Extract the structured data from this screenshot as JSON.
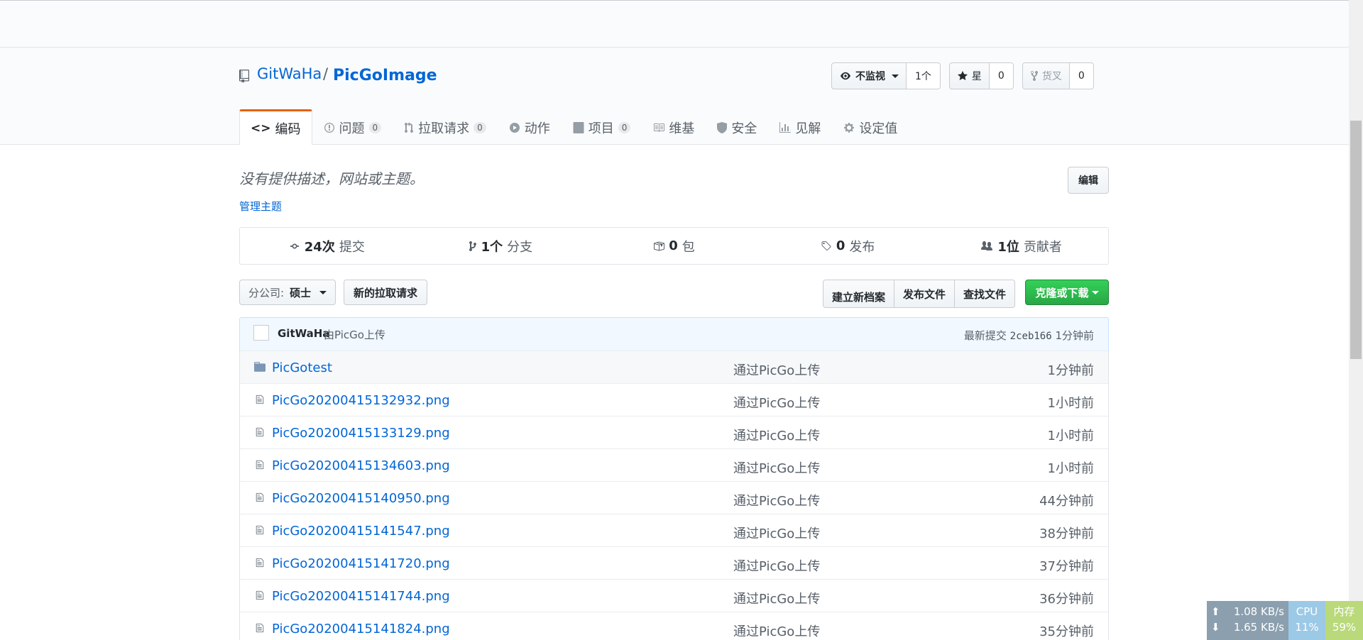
{
  "repo": {
    "owner": "GitWaHa",
    "slash": "/",
    "name": "PicGoImage"
  },
  "actions": {
    "watch_label": "不监视",
    "watch_count": "1个",
    "star_label": "星",
    "star_count": "0",
    "fork_label": "货叉",
    "fork_count": "0"
  },
  "tabs": [
    {
      "label": "编码",
      "icon": "code-icon",
      "counter": null
    },
    {
      "label": "问题",
      "icon": "issue-icon",
      "counter": "0"
    },
    {
      "label": "拉取请求",
      "icon": "pull-request-icon",
      "counter": "0"
    },
    {
      "label": "动作",
      "icon": "play-icon",
      "counter": null
    },
    {
      "label": "项目",
      "icon": "project-icon",
      "counter": "0"
    },
    {
      "label": "维基",
      "icon": "book-icon",
      "counter": null
    },
    {
      "label": "安全",
      "icon": "shield-icon",
      "counter": null
    },
    {
      "label": "见解",
      "icon": "graph-icon",
      "counter": null
    },
    {
      "label": "设定值",
      "icon": "gear-icon",
      "counter": null
    }
  ],
  "about": {
    "description": "没有提供描述，网站或主题。",
    "manage_topics": "管理主题",
    "edit_label": "编辑"
  },
  "summary": {
    "commits_num": "24次",
    "commits_label": "提交",
    "branches_num": "1个",
    "branches_label": "分支",
    "packages_num": "0",
    "packages_label": "包",
    "releases_num": "0",
    "releases_label": "发布",
    "contributors_num": "1位",
    "contributors_label": "贡献者"
  },
  "file_nav": {
    "branch_label": "分公司:",
    "branch_value": "硕士",
    "new_pr": "新的拉取请求",
    "create_file": "建立新档案",
    "upload_files": "发布文件",
    "find_file": "查找文件",
    "clone": "克隆或下载"
  },
  "commit": {
    "author": "GitWaHa",
    "message": "由PicGo上传",
    "latest_label": "最新提交",
    "sha": "2ceb166",
    "age": "1分钟前"
  },
  "files": [
    {
      "type": "dir",
      "name": "PicGotest",
      "message": "通过PicGo上传",
      "age": "1分钟前"
    },
    {
      "type": "file",
      "name": "PicGo20200415132932.png",
      "message": "通过PicGo上传",
      "age": "1小时前"
    },
    {
      "type": "file",
      "name": "PicGo20200415133129.png",
      "message": "通过PicGo上传",
      "age": "1小时前"
    },
    {
      "type": "file",
      "name": "PicGo20200415134603.png",
      "message": "通过PicGo上传",
      "age": "1小时前"
    },
    {
      "type": "file",
      "name": "PicGo20200415140950.png",
      "message": "通过PicGo上传",
      "age": "44分钟前"
    },
    {
      "type": "file",
      "name": "PicGo20200415141547.png",
      "message": "通过PicGo上传",
      "age": "38分钟前"
    },
    {
      "type": "file",
      "name": "PicGo20200415141720.png",
      "message": "通过PicGo上传",
      "age": "37分钟前"
    },
    {
      "type": "file",
      "name": "PicGo20200415141744.png",
      "message": "通过PicGo上传",
      "age": "36分钟前"
    },
    {
      "type": "file",
      "name": "PicGo20200415141824.png",
      "message": "通过PicGo上传",
      "age": "35分钟前"
    }
  ],
  "net_monitor": {
    "upload": "1.08 KB/s",
    "download": "1.65 KB/s",
    "cpu_label": "CPU",
    "cpu_value": "11%",
    "mem_label": "内存",
    "mem_value": "59%"
  },
  "colors": {
    "link": "#0366d6",
    "selected_tab_accent": "#e36209",
    "clone_button": "#28a745"
  }
}
